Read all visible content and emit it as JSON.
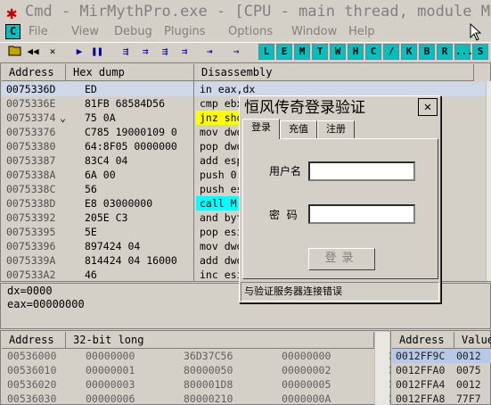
{
  "window": {
    "title": "Cmd - MirMythPro.exe - [CPU - main thread, module Mi"
  },
  "menubar": {
    "c_box": "C",
    "items": [
      "File",
      "View",
      "Debug",
      "Plugins",
      "Options",
      "Window",
      "Help"
    ]
  },
  "toolbar": {
    "buttons": [
      "open-icon",
      "rewind-icon",
      "close-icon",
      "run-icon",
      "pause-icon",
      "step-into-icon",
      "step-over-icon",
      "trace-into-icon",
      "trace-over-icon",
      "execute-till-return-icon",
      "goto-icon"
    ],
    "letters": [
      "L",
      "E",
      "M",
      "T",
      "W",
      "H",
      "C",
      "/",
      "K",
      "B",
      "R",
      "...",
      "S"
    ]
  },
  "cpu": {
    "headers": {
      "address": "Address",
      "hex": "Hex dump",
      "disasm": "Disassembly"
    },
    "rows": [
      {
        "addr": "0075336D",
        "hex": "ED",
        "dis": "in eax,dx",
        "sel": true
      },
      {
        "addr": "0075336E",
        "hex": "81FB 68584D56",
        "dis": "cmp ebx,564D5868"
      },
      {
        "addr": "00753374",
        "hex": "75 0A",
        "dis": "jnz short",
        "mark": "yellow",
        "arrow": "⌄"
      },
      {
        "addr": "00753376",
        "hex": "C785 19000109 0",
        "dis": "mov dword"
      },
      {
        "addr": "00753380",
        "hex": "64:8F05 0000000",
        "dis": "pop dword"
      },
      {
        "addr": "00753387",
        "hex": "83C4 04",
        "dis": "add esp"
      },
      {
        "addr": "0075338A",
        "hex": "6A 00",
        "dis": "push 0"
      },
      {
        "addr": "0075338C",
        "hex": "56",
        "dis": "push esi"
      },
      {
        "addr": "0075338D",
        "hex": "E8 03000000",
        "dis": "call M",
        "mark": "cyan"
      },
      {
        "addr": "00753392",
        "hex": "205E C3",
        "dis": "and byte"
      },
      {
        "addr": "00753395",
        "hex": "5E",
        "dis": "pop esi"
      },
      {
        "addr": "00753396",
        "hex": "897424 04",
        "dis": "mov dwo"
      },
      {
        "addr": "0075339A",
        "hex": "814424 04 16000",
        "dis": "add dwo"
      },
      {
        "addr": "007533A2",
        "hex": "46",
        "dis": "inc esi"
      }
    ]
  },
  "registers": {
    "lines": [
      "dx=0000",
      "eax=00000000"
    ]
  },
  "dump": {
    "headers": {
      "address": "Address",
      "value": "32-bit long"
    },
    "rows": [
      [
        "00536000",
        "00000000",
        "36D37C56",
        "00000000",
        "000"
      ],
      [
        "00536010",
        "00000001",
        "80000050",
        "00000002",
        "800"
      ],
      [
        "00536020",
        "00000003",
        "800001D8",
        "00000005",
        "800"
      ],
      [
        "00536030",
        "00000006",
        "80000210",
        "0000000A",
        "800"
      ]
    ]
  },
  "stack": {
    "headers": {
      "address": "Address",
      "value": "Value"
    },
    "rows": [
      {
        "addr": "0012FF9C",
        "val": "0012",
        "sel": true
      },
      {
        "addr": "0012FFA0",
        "val": "0075"
      },
      {
        "addr": "0012FFA4",
        "val": "0012"
      },
      {
        "addr": "0012FFA8",
        "val": "77F7"
      }
    ]
  },
  "dialog": {
    "title": "恒风传奇登录验证",
    "close": "✕",
    "tabs": [
      "登录",
      "充值",
      "注册"
    ],
    "username_label": "用户名",
    "password_label": "密  码",
    "username_value": "",
    "password_value": "",
    "login_button": "登录",
    "status": "与验证服务器连接错误"
  },
  "colors": {
    "bg": "#d4d0c8",
    "highlight_yellow": "#ffff00",
    "highlight_cyan": "#00ffff",
    "selected_row": "#cfd8e8"
  }
}
